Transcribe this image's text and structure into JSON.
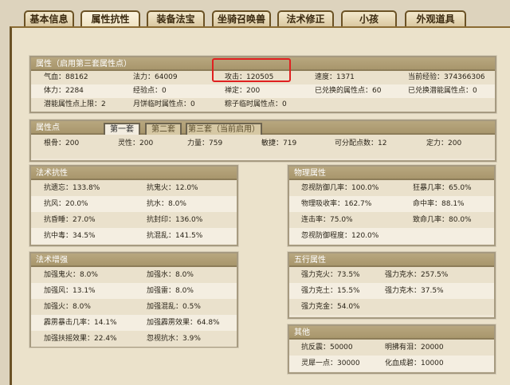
{
  "tabs": [
    "基本信息",
    "属性抗性",
    "装备法宝",
    "坐骑召唤兽",
    "法术修正",
    "小孩",
    "外观道具"
  ],
  "attributes": {
    "title": "属性（启用第三套属性点）",
    "rows": [
      [
        "气血：88162",
        "法力：64009",
        "攻击：120505",
        "速度：1371",
        "当前经验：374366306"
      ],
      [
        "体力：2284",
        "经验点：0",
        "禅定：200",
        "已兑换的属性点：60",
        "已兑换潜能属性点：0"
      ],
      [
        "潜能属性点上限：2",
        "月饼临时属性点：0",
        "粽子临时属性点：0",
        "",
        ""
      ]
    ]
  },
  "points": {
    "title": "属性点",
    "tabs": [
      "第一套",
      "第二套",
      "第三套（当前启用）"
    ],
    "values": [
      "根骨：200",
      "灵性：200",
      "力量：759",
      "敏捷：719",
      "可分配点数：12",
      "定力：200"
    ]
  },
  "magic_resist": {
    "title": "法术抗性",
    "rows": [
      [
        "抗遗忘：133.8%",
        "抗鬼火：12.0%"
      ],
      [
        "抗风：20.0%",
        "抗水：8.0%"
      ],
      [
        "抗昏睡：27.0%",
        "抗封印：136.0%"
      ],
      [
        "抗中毒：34.5%",
        "抗混乱：141.5%"
      ]
    ]
  },
  "physical": {
    "title": "物理属性",
    "rows": [
      [
        "忽视防御几率：100.0%",
        "狂暴几率：65.0%"
      ],
      [
        "物理吸收率：162.7%",
        "命中率：88.1%"
      ],
      [
        "连击率：75.0%",
        "致命几率：80.0%"
      ],
      [
        "忽视防御程度：120.0%",
        ""
      ]
    ]
  },
  "magic_boost": {
    "title": "法术增强",
    "rows": [
      [
        "加强鬼火：8.0%",
        "加强水：8.0%"
      ],
      [
        "加强风：13.1%",
        "加强雷：8.0%"
      ],
      [
        "加强火：8.0%",
        "加强混乱：0.5%"
      ],
      [
        "霹雳暴击几率：14.1%",
        "加强霹雳效果：64.8%"
      ],
      [
        "加强扶摇效果：22.4%",
        "忽视抗水：3.9%"
      ]
    ]
  },
  "five_elements": {
    "title": "五行属性",
    "rows": [
      [
        "强力克火：73.5%",
        "强力克水：257.5%"
      ],
      [
        "强力克土：15.5%",
        "强力克木：37.5%"
      ],
      [
        "强力克金：54.0%",
        ""
      ]
    ]
  },
  "other": {
    "title": "其他",
    "rows": [
      [
        "抗反震：50000",
        "明拂有泪：20000"
      ],
      [
        "灵犀一点：30000",
        "化血成碧：10000"
      ]
    ]
  }
}
